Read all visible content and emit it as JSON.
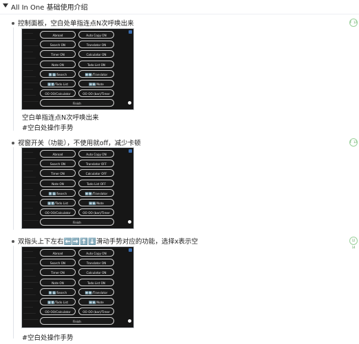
{
  "title": "All In One 基础使用介绍",
  "items": [
    {
      "text": "控制面板，空白处单指连点N次呼唤出来",
      "badge": "F 13",
      "buttons": [
        [
          "Abroad",
          "Auto Copy ON"
        ],
        [
          "Search ON",
          "Translator ON"
        ],
        [
          "Timer ON",
          "Calculator ON"
        ],
        [
          "Note ON",
          "Todo List ON"
        ],
        [
          "⬆️⬇️/Search",
          "⬅️➡️/Translator"
        ],
        [
          "⬇️⬆️/Todo List",
          "➡️⬅️/Note"
        ],
        [
          "OO OO/Calculator",
          "OO OO (bar)/Timer"
        ]
      ],
      "finish": "Finish",
      "notes": [
        "空白单指连点N次呼唤出来",
        "#空白处操作手势"
      ]
    },
    {
      "text": "视窗开关（功能），不使用就off，减少卡顿",
      "badge": "F 13",
      "buttons": [
        [
          "Abroad",
          "Auto Copy ON"
        ],
        [
          "Search ON",
          "Translator OFF"
        ],
        [
          "Timer ON",
          "Calculator OFF"
        ],
        [
          "Note ON",
          "Todo List OFF"
        ],
        [
          "⬆️⬇️/Search",
          "⬅️➡️/Translator"
        ],
        [
          "⬇️⬆️/Todo List",
          "➡️⬅️/Note"
        ],
        [
          "OO OO/Calculator",
          "OO OO (bar)/Timer"
        ]
      ],
      "finish": "Finish",
      "notes": []
    },
    {
      "text": "双指头上下左右⬅️➡️⬆️⬇️滑动手势对应的功能，选择x表示空",
      "badge": "12 14",
      "buttons": [
        [
          "Abroad",
          "Auto Copy ON"
        ],
        [
          "Search ON",
          "Translator ON"
        ],
        [
          "Timer ON",
          "Calculator ON"
        ],
        [
          "Note ON",
          "Todo List ON"
        ],
        [
          "⬆️⬇️/Search",
          "⬅️➡️/Translator"
        ],
        [
          "⬇️⬆️/Todo List",
          "➡️⬅️/Note"
        ],
        [
          "OO OO/Calculator",
          "OO OO (bar)/Timer"
        ]
      ],
      "finish": "Finish",
      "notes": [
        "#空白处操作手势"
      ]
    }
  ]
}
